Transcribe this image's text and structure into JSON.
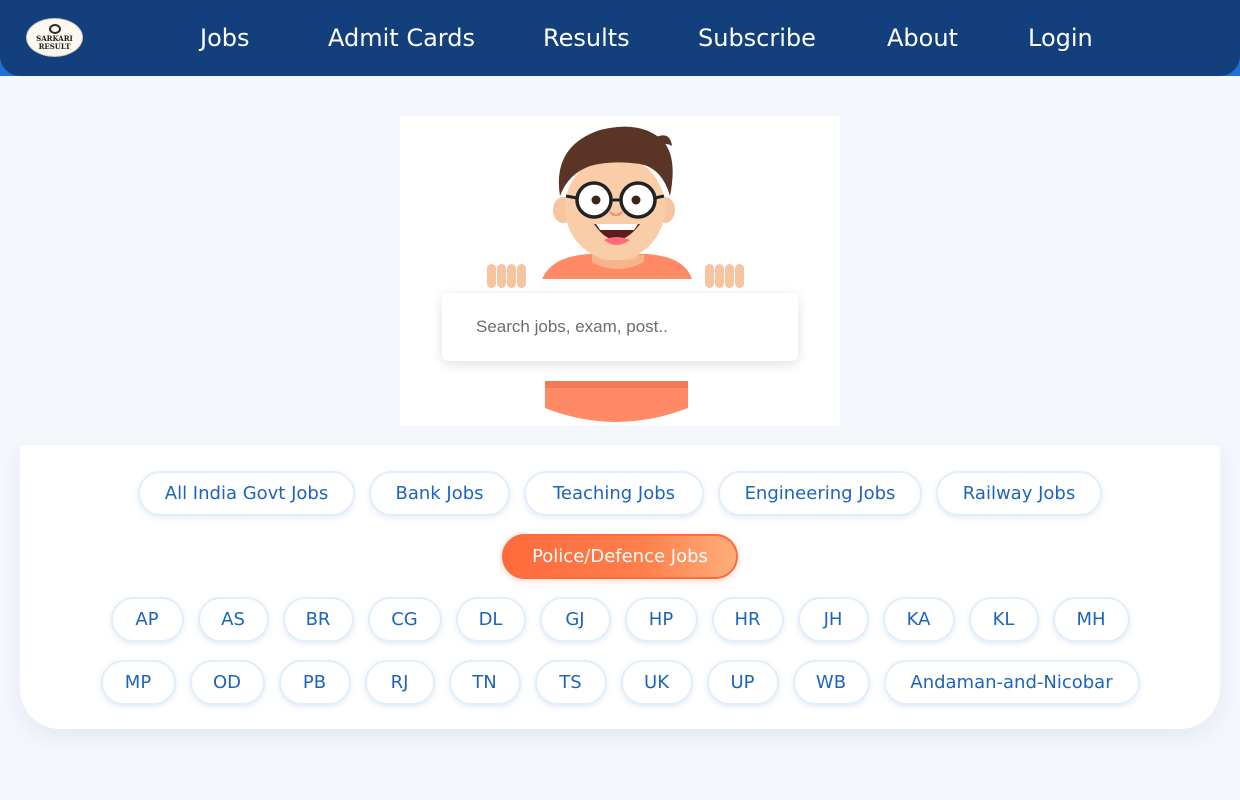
{
  "header": {
    "logo": {
      "line1": "SARKARI",
      "line2": "RESULT"
    },
    "nav": [
      "Jobs",
      "Admit Cards",
      "Results",
      "Subscribe",
      "About",
      "Login"
    ],
    "colors": {
      "bar": "#133f7d",
      "accent_strip": "#1e74d6"
    }
  },
  "hero": {
    "illustration": "cartoon-boy-with-glasses",
    "search_placeholder": "Search jobs, exam, post.."
  },
  "categories": {
    "row1": [
      "All India Govt Jobs",
      "Bank Jobs",
      "Teaching Jobs",
      "Engineering Jobs",
      "Railway Jobs"
    ],
    "row2_active": "Police/Defence Jobs",
    "active_color": "#ff6a3d"
  },
  "states": {
    "row1": [
      "AP",
      "AS",
      "BR",
      "CG",
      "DL",
      "GJ",
      "HP",
      "HR",
      "JH",
      "KA",
      "KL",
      "MH"
    ],
    "row2": [
      "MP",
      "OD",
      "PB",
      "RJ",
      "TN",
      "TS",
      "UK",
      "UP",
      "WB",
      "Andaman-and-Nicobar"
    ]
  }
}
